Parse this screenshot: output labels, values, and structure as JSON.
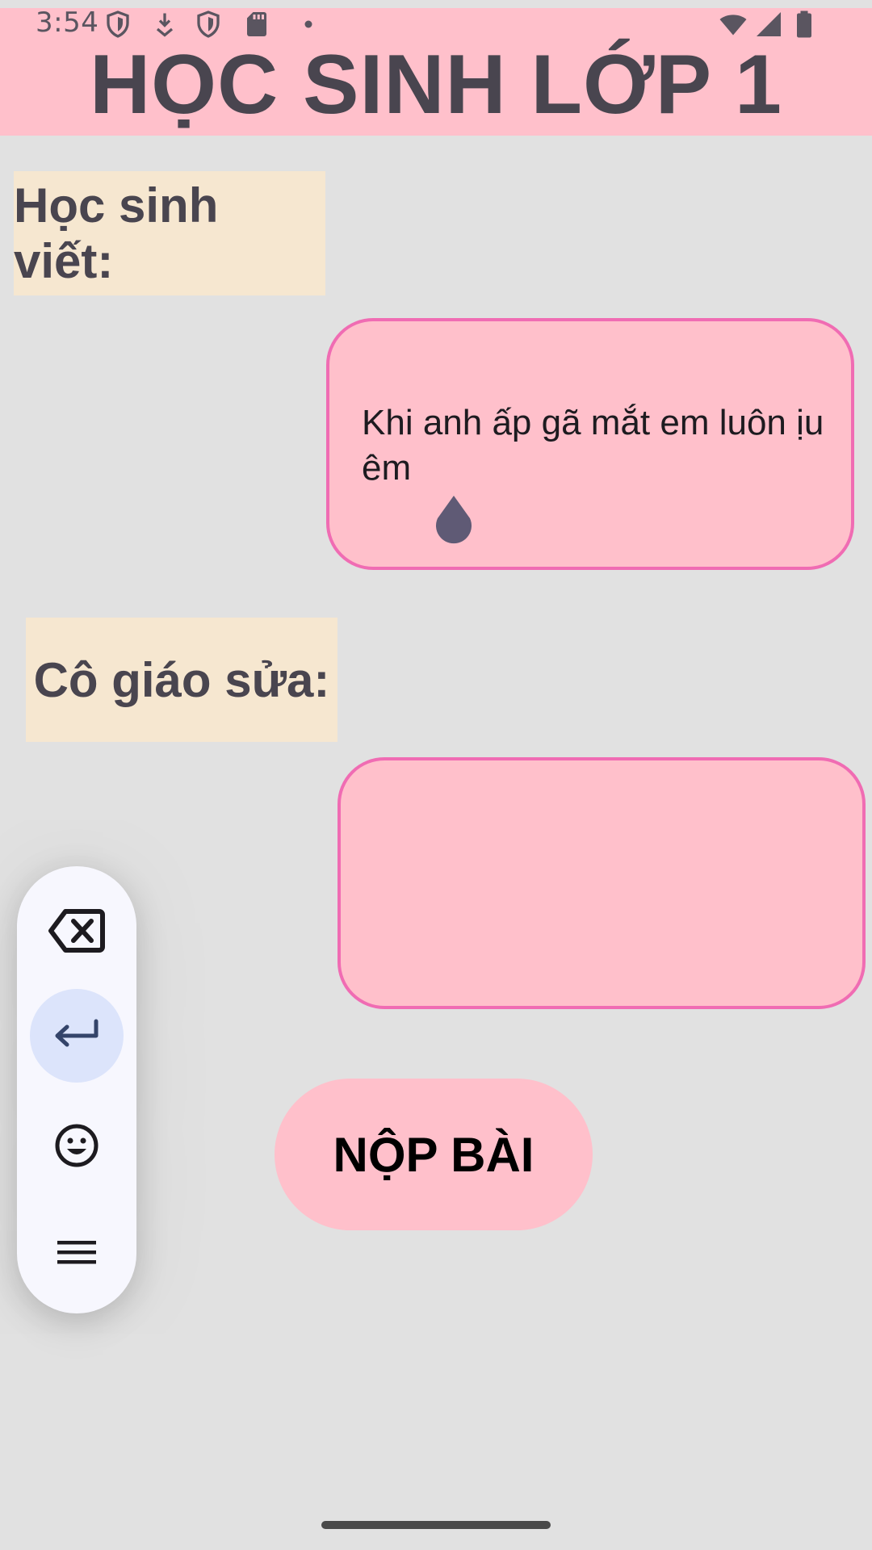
{
  "status_bar": {
    "time": "3:54",
    "icons_left": [
      "shield-icon",
      "download-icon",
      "shield-icon",
      "sd-card-icon",
      "dot-icon"
    ],
    "icons_right": [
      "wifi-icon",
      "signal-icon",
      "battery-icon"
    ]
  },
  "header": {
    "title": "HỌC SINH LỚP 1",
    "background": "#ffc0cb"
  },
  "student": {
    "label": "Học sinh viết:",
    "text": "Khi anh ấp gã mắt em luôn ịu êm"
  },
  "teacher": {
    "label": "Cô giáo sửa:",
    "text": ""
  },
  "submit_button": {
    "label": "NỘP BÀI"
  },
  "floating_toolbar": {
    "items": [
      "backspace-icon",
      "enter-icon",
      "emoji-icon",
      "menu-icon"
    ],
    "active_item": "enter-icon"
  },
  "colors": {
    "background": "#e1e1e1",
    "accent_pink": "#ffc0cb",
    "border_pink": "#f06cb3",
    "label_bg": "#f6e7d0",
    "active_toolbar": "#dce4fb"
  }
}
